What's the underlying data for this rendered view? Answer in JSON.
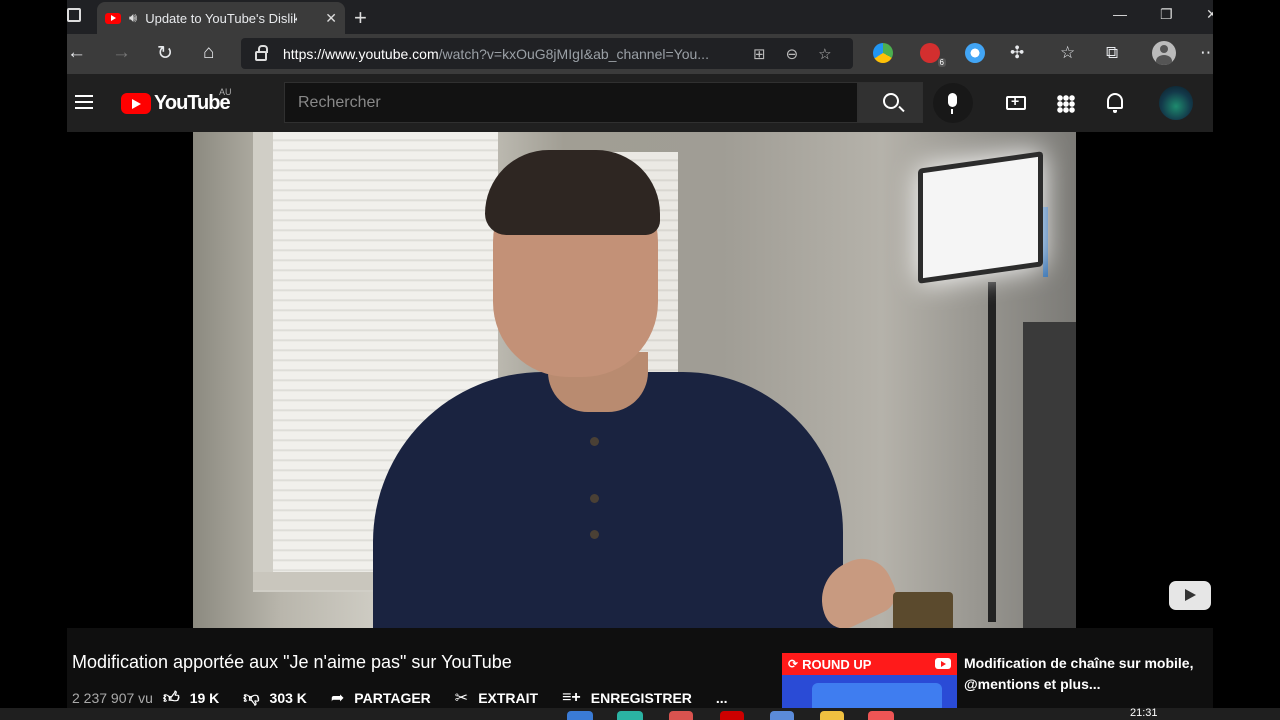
{
  "browser": {
    "tab_title": "Update to YouTube's Dislike",
    "url_host": "https://www.youtube.com",
    "url_path": "/watch?v=kxOuG8jMIgI&ab_channel=You...",
    "extension_badge": "6"
  },
  "youtube": {
    "wordmark": "YouTube",
    "region": "AU",
    "search_placeholder": "Rechercher"
  },
  "video": {
    "title": "Modification apportée aux \"Je n'aime pas\" sur YouTube",
    "views": "2 237 907 vu",
    "likes": "19 K",
    "dislikes": "303 K",
    "share_label": "PARTAGER",
    "clip_label": "EXTRAIT",
    "save_label": "ENREGISTRER",
    "more_label": "..."
  },
  "suggestion": {
    "band_label": "ROUND UP",
    "title": "Modification de chaîne sur mobile, @mentions et plus..."
  },
  "taskbar": {
    "time": "21:31"
  },
  "colors": {
    "youtube_red": "#ff0000",
    "background": "#0f0f0f"
  }
}
